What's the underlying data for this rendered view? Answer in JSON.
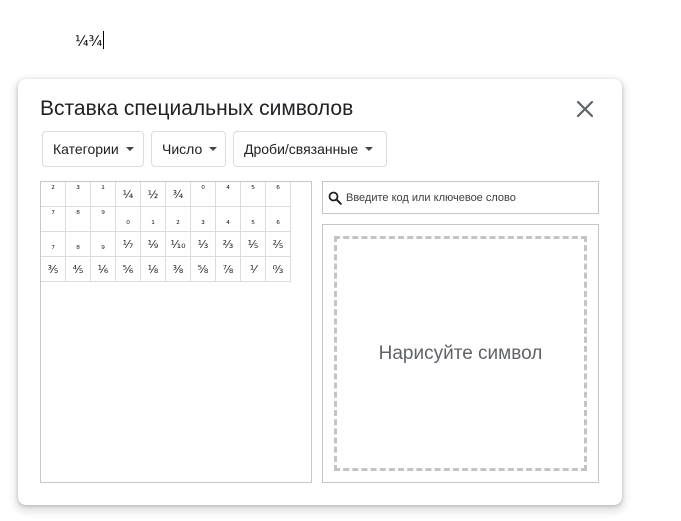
{
  "document": {
    "text": "¼¾"
  },
  "dialog": {
    "title": "Вставка специальных символов",
    "close_icon": "close-icon",
    "dropdowns": [
      {
        "label": "Категории"
      },
      {
        "label": "Число"
      },
      {
        "label": "Дроби/связанные"
      }
    ],
    "symbols": [
      {
        "char": "²",
        "pos": "sup"
      },
      {
        "char": "³",
        "pos": "sup"
      },
      {
        "char": "¹",
        "pos": "sup"
      },
      {
        "char": "¼",
        "pos": "mid"
      },
      {
        "char": "½",
        "pos": "mid"
      },
      {
        "char": "¾",
        "pos": "mid"
      },
      {
        "char": "⁰",
        "pos": "sup"
      },
      {
        "char": "⁴",
        "pos": "sup"
      },
      {
        "char": "⁵",
        "pos": "sup"
      },
      {
        "char": "⁶",
        "pos": "sup"
      },
      {
        "char": "⁷",
        "pos": "sup"
      },
      {
        "char": "⁸",
        "pos": "sup"
      },
      {
        "char": "⁹",
        "pos": "sup"
      },
      {
        "char": "₀",
        "pos": "sub"
      },
      {
        "char": "₁",
        "pos": "sub"
      },
      {
        "char": "₂",
        "pos": "sub"
      },
      {
        "char": "₃",
        "pos": "sub"
      },
      {
        "char": "₄",
        "pos": "sub"
      },
      {
        "char": "₅",
        "pos": "sub"
      },
      {
        "char": "₆",
        "pos": "sub"
      },
      {
        "char": "₇",
        "pos": "sub"
      },
      {
        "char": "₈",
        "pos": "sub"
      },
      {
        "char": "₉",
        "pos": "sub"
      },
      {
        "char": "⅐",
        "pos": "mid"
      },
      {
        "char": "⅑",
        "pos": "mid"
      },
      {
        "char": "⅒",
        "pos": "mid"
      },
      {
        "char": "⅓",
        "pos": "mid"
      },
      {
        "char": "⅔",
        "pos": "mid"
      },
      {
        "char": "⅕",
        "pos": "mid"
      },
      {
        "char": "⅖",
        "pos": "mid"
      },
      {
        "char": "⅗",
        "pos": "mid"
      },
      {
        "char": "⅘",
        "pos": "mid"
      },
      {
        "char": "⅙",
        "pos": "mid"
      },
      {
        "char": "⅚",
        "pos": "mid"
      },
      {
        "char": "⅛",
        "pos": "mid"
      },
      {
        "char": "⅜",
        "pos": "mid"
      },
      {
        "char": "⅝",
        "pos": "mid"
      },
      {
        "char": "⅞",
        "pos": "mid"
      },
      {
        "char": "⅟",
        "pos": "mid"
      },
      {
        "char": "↉",
        "pos": "mid"
      }
    ],
    "search": {
      "icon": "search-icon",
      "placeholder": "Введите код или ключевое слово"
    },
    "draw": {
      "label": "Нарисуйте символ"
    }
  }
}
